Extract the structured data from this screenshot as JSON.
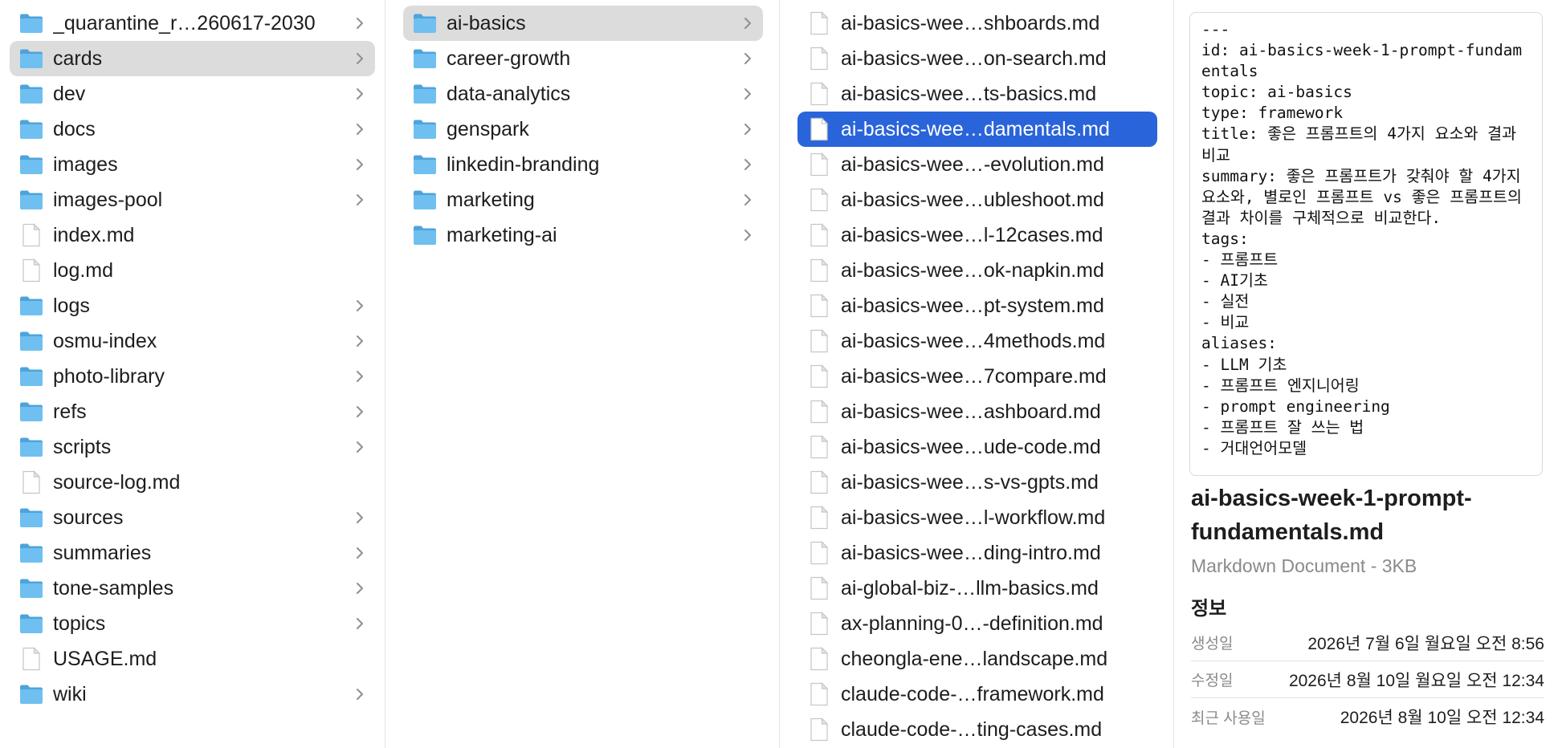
{
  "columns": {
    "root": [
      {
        "label": "_quarantine_r…260617-2030",
        "kind": "folder"
      },
      {
        "label": "cards",
        "kind": "folder",
        "selected": "gray"
      },
      {
        "label": "dev",
        "kind": "folder"
      },
      {
        "label": "docs",
        "kind": "folder"
      },
      {
        "label": "images",
        "kind": "folder"
      },
      {
        "label": "images-pool",
        "kind": "folder"
      },
      {
        "label": "index.md",
        "kind": "file"
      },
      {
        "label": "log.md",
        "kind": "file"
      },
      {
        "label": "logs",
        "kind": "folder"
      },
      {
        "label": "osmu-index",
        "kind": "folder"
      },
      {
        "label": "photo-library",
        "kind": "folder"
      },
      {
        "label": "refs",
        "kind": "folder"
      },
      {
        "label": "scripts",
        "kind": "folder"
      },
      {
        "label": "source-log.md",
        "kind": "file"
      },
      {
        "label": "sources",
        "kind": "folder"
      },
      {
        "label": "summaries",
        "kind": "folder"
      },
      {
        "label": "tone-samples",
        "kind": "folder"
      },
      {
        "label": "topics",
        "kind": "folder"
      },
      {
        "label": "USAGE.md",
        "kind": "file"
      },
      {
        "label": "wiki",
        "kind": "folder"
      }
    ],
    "cards": [
      {
        "label": "ai-basics",
        "kind": "folder",
        "selected": "gray"
      },
      {
        "label": "career-growth",
        "kind": "folder"
      },
      {
        "label": "data-analytics",
        "kind": "folder"
      },
      {
        "label": "genspark",
        "kind": "folder"
      },
      {
        "label": "linkedin-branding",
        "kind": "folder"
      },
      {
        "label": "marketing",
        "kind": "folder"
      },
      {
        "label": "marketing-ai",
        "kind": "folder"
      }
    ],
    "ai_basics": [
      {
        "label": "ai-basics-wee…shboards.md",
        "kind": "file"
      },
      {
        "label": "ai-basics-wee…on-search.md",
        "kind": "file"
      },
      {
        "label": "ai-basics-wee…ts-basics.md",
        "kind": "file"
      },
      {
        "label": "ai-basics-wee…damentals.md",
        "kind": "file",
        "selected": "blue"
      },
      {
        "label": "ai-basics-wee…-evolution.md",
        "kind": "file"
      },
      {
        "label": "ai-basics-wee…ubleshoot.md",
        "kind": "file"
      },
      {
        "label": "ai-basics-wee…l-12cases.md",
        "kind": "file"
      },
      {
        "label": "ai-basics-wee…ok-napkin.md",
        "kind": "file"
      },
      {
        "label": "ai-basics-wee…pt-system.md",
        "kind": "file"
      },
      {
        "label": "ai-basics-wee…4methods.md",
        "kind": "file"
      },
      {
        "label": "ai-basics-wee…7compare.md",
        "kind": "file"
      },
      {
        "label": "ai-basics-wee…ashboard.md",
        "kind": "file"
      },
      {
        "label": "ai-basics-wee…ude-code.md",
        "kind": "file"
      },
      {
        "label": "ai-basics-wee…s-vs-gpts.md",
        "kind": "file"
      },
      {
        "label": "ai-basics-wee…l-workflow.md",
        "kind": "file"
      },
      {
        "label": "ai-basics-wee…ding-intro.md",
        "kind": "file"
      },
      {
        "label": "ai-global-biz-…llm-basics.md",
        "kind": "file"
      },
      {
        "label": "ax-planning-0…-definition.md",
        "kind": "file"
      },
      {
        "label": "cheongla-ene…landscape.md",
        "kind": "file"
      },
      {
        "label": "claude-code-…framework.md",
        "kind": "file"
      },
      {
        "label": "claude-code-…ting-cases.md",
        "kind": "file"
      }
    ]
  },
  "preview": {
    "text": "---\nid: ai-basics-week-1-prompt-fundamentals\ntopic: ai-basics\ntype: framework\ntitle: 좋은 프롬프트의 4가지 요소와 결과 비교\nsummary: 좋은 프롬프트가 갖춰야 할 4가지 요소와, 별로인 프롬프트 vs 좋은 프롬프트의 결과 차이를 구체적으로 비교한다.\ntags:\n- 프롬프트\n- AI기초\n- 실전\n- 비교\naliases:\n- LLM 기초\n- 프롬프트 엔지니어링\n- prompt engineering\n- 프롬프트 잘 쓰는 법\n- 거대언어모델",
    "filename": "ai-basics-week-1-prompt-fundamentals.md",
    "filetype": "Markdown Document - 3KB",
    "info_heading": "정보",
    "meta": [
      {
        "key": "생성일",
        "value": "2026년 7월 6일 월요일 오전 8:56"
      },
      {
        "key": "수정일",
        "value": "2026년 8월 10일 월요일 오전 12:34"
      },
      {
        "key": "최근 사용일",
        "value": "2026년 8월 10일 오전 12:34"
      }
    ]
  },
  "colors": {
    "folder": "#5ab4ec",
    "selection_blue": "#2a64da",
    "selection_gray": "#dcdcdc"
  },
  "icons": {
    "folder": "folder-icon",
    "file": "document-icon",
    "chevron": "chevron-right-icon"
  }
}
